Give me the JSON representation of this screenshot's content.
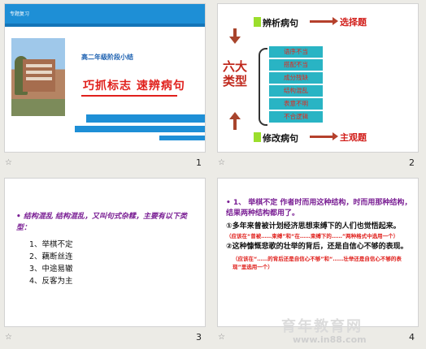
{
  "slides": [
    {
      "number": "1",
      "tag": "专题复习",
      "subtitle": "高二年级阶段小结",
      "title": "巧抓标志  速辨病句"
    },
    {
      "number": "2",
      "left_label": "六大类型",
      "top_head": "辨析病句",
      "top_right": "选择题",
      "bottom_head": "修改病句",
      "bottom_right": "主观题",
      "items": [
        "语序不当",
        "搭配不当",
        "成分残缺",
        "结构混乱",
        "表意不明",
        "不合逻辑"
      ]
    },
    {
      "number": "3",
      "intro": "• 结构混乱 结构混乱，又叫句式杂糅，主要有以下类型：",
      "list": [
        "1、举棋不定",
        "2、藕断丝连",
        "3、中途易辙",
        "4、反客为主"
      ]
    },
    {
      "number": "4",
      "point": "• 1、  举棋不定  作者时而用这种结构，时而用那种结构，结果两种结构都用了。",
      "ex1": "①多年来曾被计划经济思想束缚下的人们也觉悟起来。",
      "note1": "（应该在“曾被……束缚”和“在……束缚下的……”两种格式中选用一个）",
      "ex2": "②这种慷慨悲歌的壮举的背后，还是自信心不够的表现。",
      "note2": "（应该在“……的背后还是自信心不够”和“……壮举还是自信心不够的表现”里选用一个）"
    }
  ],
  "footer_icon": "star-icon",
  "watermark": "育年教育网",
  "watermark_url": "www.in88.com"
}
